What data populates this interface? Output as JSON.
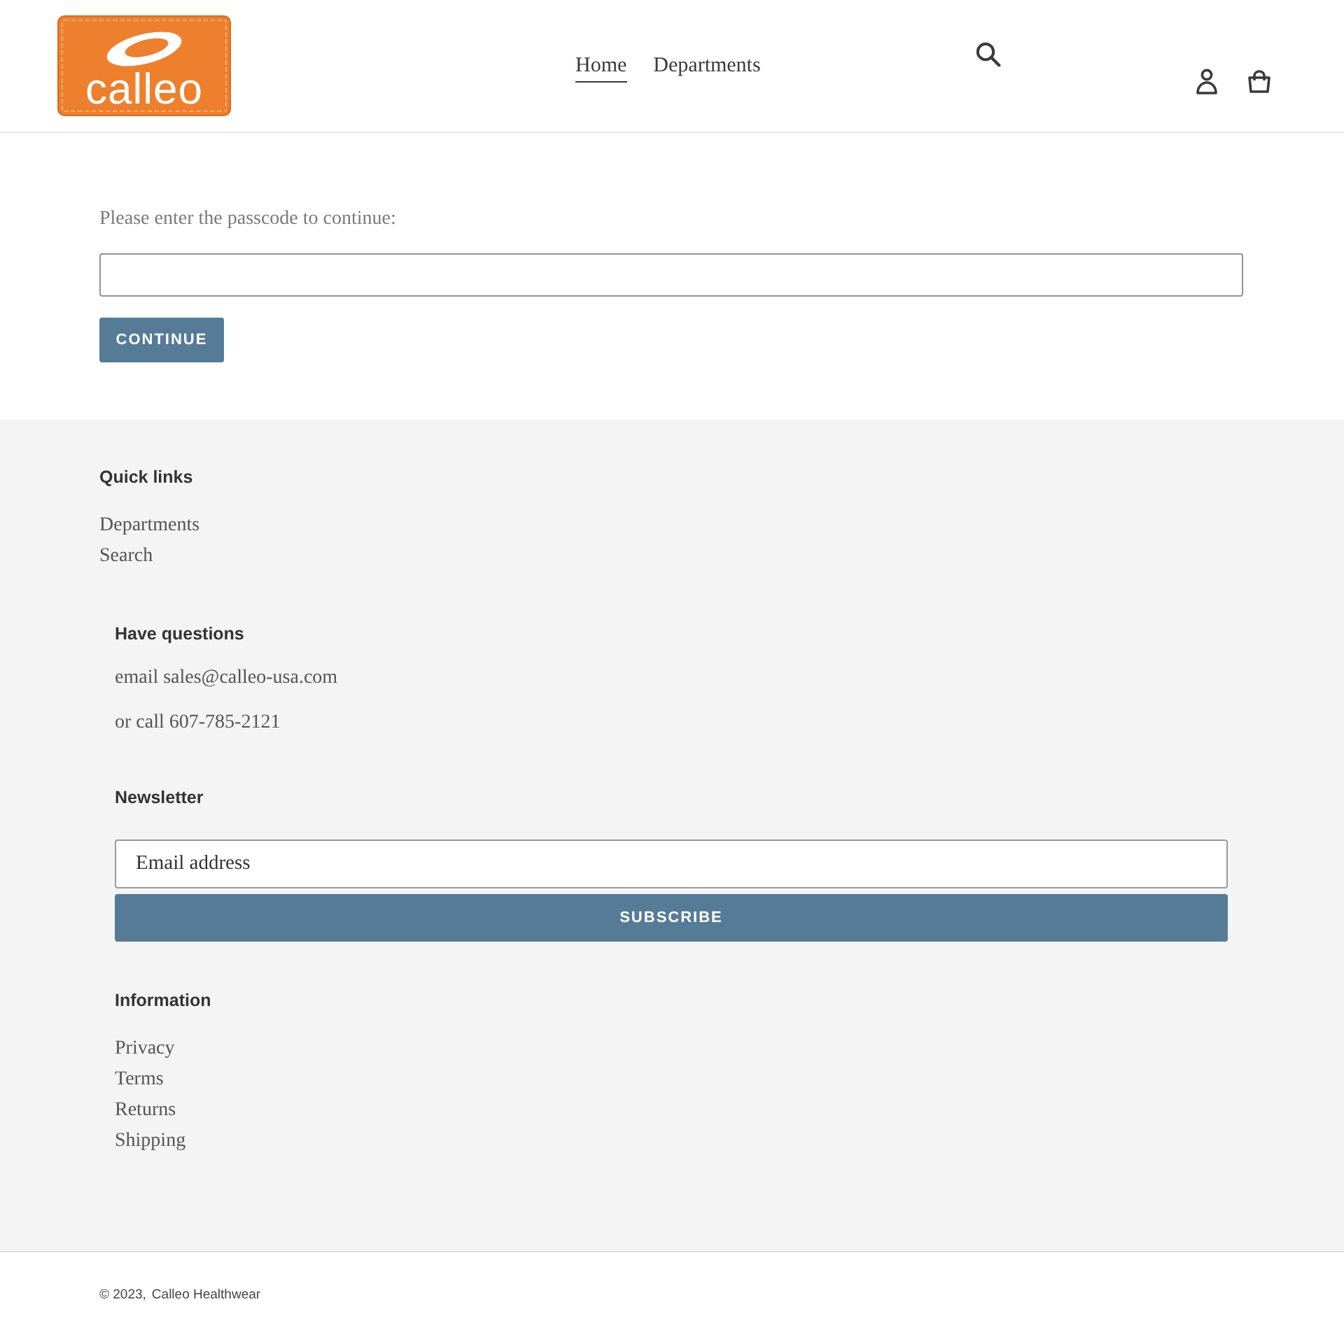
{
  "header": {
    "logo": {
      "text": "calleo"
    },
    "nav": [
      {
        "label": "Home",
        "selected": true
      },
      {
        "label": "Departments",
        "selected": false
      }
    ]
  },
  "passcode_form": {
    "prompt": "Please enter the passcode to continue:",
    "button": "CONTINUE"
  },
  "footer": {
    "quick_links": {
      "title": "Quick links",
      "links": [
        "Departments",
        "Search"
      ]
    },
    "contact": {
      "title": "Have questions",
      "lines": [
        "email sales@calleo-usa.com",
        "or call 607-785-2121"
      ]
    },
    "newsletter": {
      "title": "Newsletter",
      "placeholder": "Email address",
      "button": "SUBSCRIBE"
    },
    "information": {
      "title": "Information",
      "links": [
        "Privacy",
        "Terms",
        "Returns",
        "Shipping"
      ]
    }
  },
  "copyright": {
    "text": "© 2023,",
    "link": "Calleo Healthwear"
  }
}
